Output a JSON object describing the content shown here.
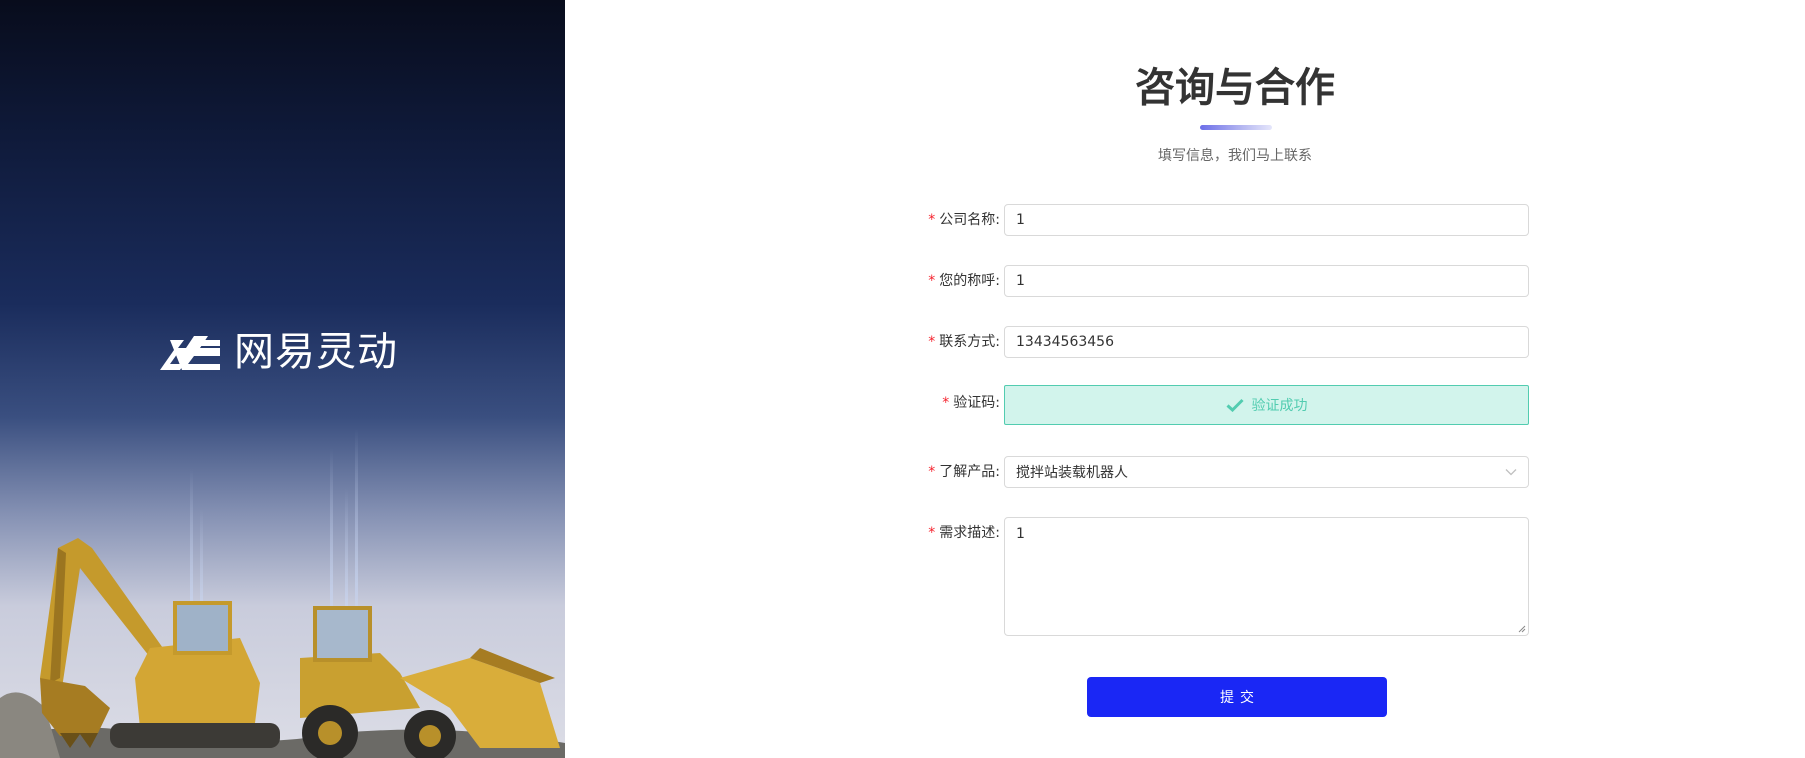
{
  "brand": {
    "name": "网易灵动"
  },
  "form": {
    "title": "咨询与合作",
    "subtitle": "填写信息，我们马上联系",
    "required_mark": "*",
    "company": {
      "label": "公司名称:",
      "value": "1"
    },
    "name": {
      "label": "您的称呼:",
      "value": "1"
    },
    "contact": {
      "label": "联系方式:",
      "value": "13434563456"
    },
    "captcha": {
      "label": "验证码:",
      "status": "验证成功"
    },
    "product": {
      "label": "了解产品:",
      "selected": "搅拌站装载机器人"
    },
    "description": {
      "label": "需求描述:",
      "value": "1"
    },
    "submit_label": "提交"
  },
  "colors": {
    "accent": "#1a27f5",
    "success_border": "#52ccb0",
    "success_bg": "#d2f4ec",
    "required": "#f5222d"
  },
  "icons": [
    "brand-logo-icon",
    "check-icon",
    "chevron-down-icon",
    "resize-handle-icon"
  ]
}
